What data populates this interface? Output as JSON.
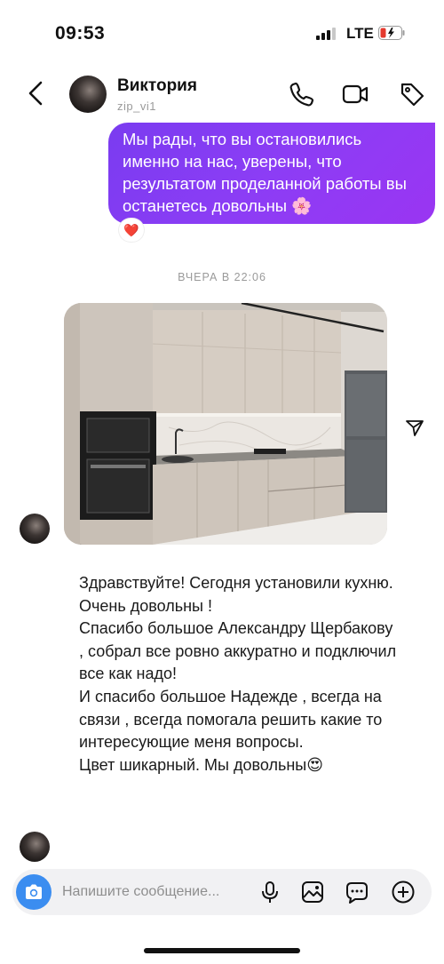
{
  "status_bar": {
    "time": "09:53",
    "network": "LTE",
    "battery_icon": "battery-charging-icon",
    "signal_icon": "signal-bars-icon"
  },
  "header": {
    "name": "Виктория",
    "username": "zip_vi1",
    "icons": [
      "back-chevron-icon",
      "phone-icon",
      "video-camera-icon",
      "tag-icon"
    ]
  },
  "messages": {
    "outgoing": {
      "text": "Мы рады, что вы остановились именно на нас, уверены, что результатом проделанной работы вы останетесь довольны 🌸",
      "reaction": "❤️"
    },
    "timestamp": "ВЧЕРА В 22:06",
    "incoming_text": "Здравствуйте! Сегодня установили кухню.\nОчень довольны !\nСпасибо большое Александру Щербакову , собрал все ровно аккуратно и подключил все как надо!\nИ спасибо большое Надежде , всегда на связи , всегда помогала решить какие то интересующие меня вопросы.\nЦвет шикарный. Мы довольны😍"
  },
  "composer": {
    "placeholder": "Напишите сообщение...",
    "icons": [
      "camera-icon",
      "microphone-icon",
      "image-gallery-icon",
      "sticker-chat-icon",
      "plus-circle-icon"
    ]
  },
  "colors": {
    "bubble_start": "#7a3cf0",
    "bubble_end": "#9a35f2",
    "camera_button": "#3b8df0",
    "timestamp": "#9a9a9a"
  }
}
